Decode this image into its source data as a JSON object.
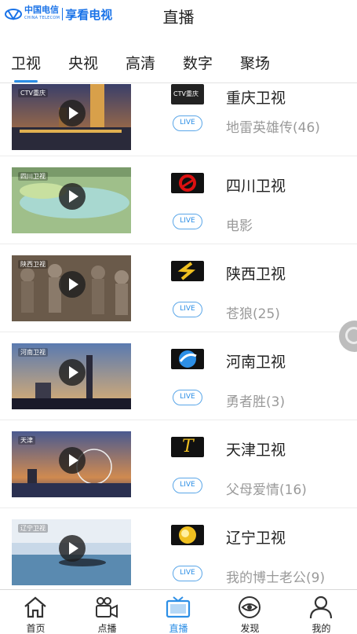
{
  "header": {
    "brand_operator": "中国电信",
    "brand_operator_en": "CHINA TELECOM",
    "brand_app": "享看电视",
    "title": "直播"
  },
  "tabs": [
    {
      "label": "卫视",
      "active": true
    },
    {
      "label": "央视",
      "active": false
    },
    {
      "label": "高清",
      "active": false
    },
    {
      "label": "数字",
      "active": false
    },
    {
      "label": "聚场",
      "active": false
    }
  ],
  "channels": [
    {
      "name": "重庆卫视",
      "live_badge": "LIVE",
      "program": "地雷英雄传(46)",
      "thumb_tag": "CTV重庆",
      "logo_text": "CTV重庆"
    },
    {
      "name": "四川卫视",
      "live_badge": "LIVE",
      "program": "电影",
      "thumb_tag": "四川卫视",
      "logo_text": ""
    },
    {
      "name": "陕西卫视",
      "live_badge": "LIVE",
      "program": "苍狼(25)",
      "thumb_tag": "陕西卫视",
      "logo_text": ""
    },
    {
      "name": "河南卫视",
      "live_badge": "LIVE",
      "program": "勇者胜(3)",
      "thumb_tag": "河南卫视",
      "logo_text": ""
    },
    {
      "name": "天津卫视",
      "live_badge": "LIVE",
      "program": "父母爱情(16)",
      "thumb_tag": "天津",
      "logo_text": "T"
    },
    {
      "name": "辽宁卫视",
      "live_badge": "LIVE",
      "program": "我的博士老公(9)",
      "thumb_tag": "辽宁卫视",
      "logo_text": ""
    }
  ],
  "bottom_nav": [
    {
      "label": "首页",
      "icon": "home-icon",
      "active": false
    },
    {
      "label": "点播",
      "icon": "video-camera-icon",
      "active": false
    },
    {
      "label": "直播",
      "icon": "tv-icon",
      "active": true
    },
    {
      "label": "发现",
      "icon": "eye-icon",
      "active": false
    },
    {
      "label": "我的",
      "icon": "user-icon",
      "active": false
    }
  ],
  "colors": {
    "accent": "#2d8fe6",
    "brand": "#1a73e8",
    "muted_text": "#9a9a9a"
  }
}
